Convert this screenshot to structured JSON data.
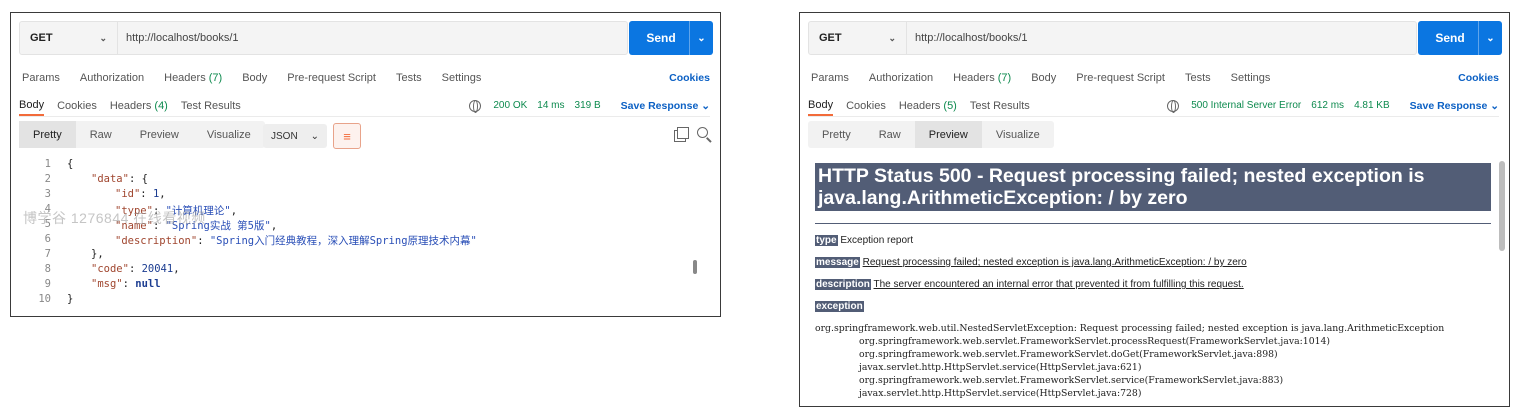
{
  "left": {
    "method": "GET",
    "url": "http://localhost/books/1",
    "send": "Send",
    "req_tabs": [
      {
        "label": "Params",
        "count": ""
      },
      {
        "label": "Authorization",
        "count": ""
      },
      {
        "label": "Headers",
        "count": "(7)"
      },
      {
        "label": "Body",
        "count": ""
      },
      {
        "label": "Pre-request Script",
        "count": ""
      },
      {
        "label": "Tests",
        "count": ""
      },
      {
        "label": "Settings",
        "count": ""
      }
    ],
    "cookies": "Cookies",
    "res_tabs": [
      {
        "label": "Body",
        "count": ""
      },
      {
        "label": "Cookies",
        "count": ""
      },
      {
        "label": "Headers",
        "count": "(4)"
      },
      {
        "label": "Test Results",
        "count": ""
      }
    ],
    "status": "200 OK",
    "time": "14 ms",
    "size": "319 B",
    "save_response": "Save Response",
    "views": [
      "Pretty",
      "Raw",
      "Preview",
      "Visualize"
    ],
    "format": "JSON",
    "line_numbers": [
      "1",
      "2",
      "3",
      "4",
      "5",
      "6",
      "7",
      "8",
      "9",
      "10"
    ],
    "code": {
      "l1": "{",
      "l2_key": "\"data\"",
      "l2_rest": ": {",
      "l3_key": "\"id\"",
      "l3_val": "1",
      "l4_key": "\"type\"",
      "l4_val": "\"计算机理论\"",
      "l5_key": "\"name\"",
      "l5_val": "\"Spring实战 第5版\"",
      "l6_key": "\"description\"",
      "l6_val": "\"Spring入门经典教程，深入理解Spring原理技术内幕\"",
      "l7": "},",
      "l8_key": "\"code\"",
      "l8_val": "20041",
      "l9_key": "\"msg\"",
      "l9_val": "null",
      "l10": "}"
    },
    "watermark": "博学谷 1276844 在线看视频"
  },
  "right": {
    "method": "GET",
    "url": "http://localhost/books/1",
    "send": "Send",
    "req_tabs": [
      {
        "label": "Params",
        "count": ""
      },
      {
        "label": "Authorization",
        "count": ""
      },
      {
        "label": "Headers",
        "count": "(7)"
      },
      {
        "label": "Body",
        "count": ""
      },
      {
        "label": "Pre-request Script",
        "count": ""
      },
      {
        "label": "Tests",
        "count": ""
      },
      {
        "label": "Settings",
        "count": ""
      }
    ],
    "cookies": "Cookies",
    "res_tabs": [
      {
        "label": "Body",
        "count": ""
      },
      {
        "label": "Cookies",
        "count": ""
      },
      {
        "label": "Headers",
        "count": "(5)"
      },
      {
        "label": "Test Results",
        "count": ""
      }
    ],
    "status": "500 Internal Server Error",
    "time": "612 ms",
    "size": "4.81 KB",
    "save_response": "Save Response",
    "views": [
      "Pretty",
      "Raw",
      "Preview",
      "Visualize"
    ],
    "preview": {
      "heading": "HTTP Status 500 - Request processing failed; nested exception is java.lang.ArithmeticException: / by zero",
      "type_label": "type",
      "type_text": "Exception report",
      "message_label": "message",
      "message_text": "Request processing failed; nested exception is java.lang.ArithmeticException: / by zero",
      "description_label": "description",
      "description_text": "The server encountered an internal error that prevented it from fulfilling this request.",
      "exception_label": "exception",
      "stack": [
        "org.springframework.web.util.NestedServletException: Request processing failed; nested exception is java.lang.ArithmeticException",
        "\torg.springframework.web.servlet.FrameworkServlet.processRequest(FrameworkServlet.java:1014)",
        "\torg.springframework.web.servlet.FrameworkServlet.doGet(FrameworkServlet.java:898)",
        "\tjavax.servlet.http.HttpServlet.service(HttpServlet.java:621)",
        "\torg.springframework.web.servlet.FrameworkServlet.service(FrameworkServlet.java:883)",
        "\tjavax.servlet.http.HttpServlet.service(HttpServlet.java:728)"
      ]
    }
  }
}
